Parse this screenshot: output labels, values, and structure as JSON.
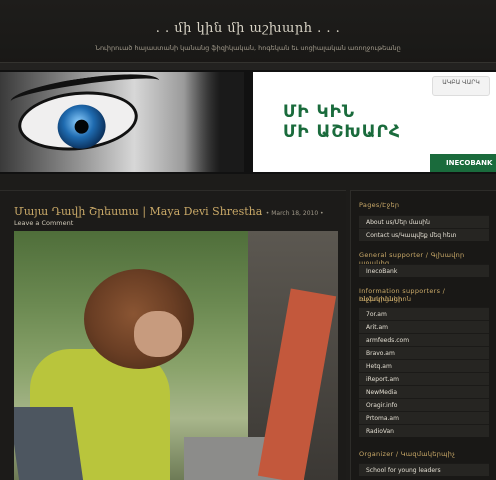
{
  "header": {
    "title": ". . մի կին մի աշխարհ . . .",
    "tagline": "Նուիրուած հայաստանի կանանց ֆիզիկական, հոգեկան եւ սոցիալական առողջութեանը"
  },
  "banner": {
    "logo_text": "ԱԿԲԱ ՎԱՐԿ",
    "slogan_line1": "ՄԻ ԿԻՆ",
    "slogan_line2": "ՄԻ ԱՇԽԱՐՀ",
    "bank_name": "INECOBANK"
  },
  "post": {
    "title": "Մայա Դավի Շրեստա | Maya Devi Shrestha",
    "date": "• March 18, 2010 •",
    "comment_link": "Leave a Comment"
  },
  "sidebar": {
    "pages": {
      "title": "Pages/Էջեր",
      "items": [
        "About us/Մեր մասին",
        "Contact us/Կապվեք մեզ հետ"
      ]
    },
    "general_supporter": {
      "title": "General supporter / Գլխավոր աջակից",
      "items": [
        "InecoBank"
      ]
    },
    "info_supporters": {
      "title_line1": "Information supporters / Ինֆորմացիոն",
      "title_line2": "աջակիցներ",
      "items": [
        "7or.am",
        "Arit.am",
        "armfeeds.com",
        "Bravo.am",
        "Hetq.am",
        "iReport.am",
        "NewMedia",
        "Oragir.info",
        "Prtoma.am",
        "RadioVan"
      ]
    },
    "organizer": {
      "title": "Organizer / Կազմակերպիչ",
      "items": [
        "School for young leaders"
      ]
    }
  }
}
